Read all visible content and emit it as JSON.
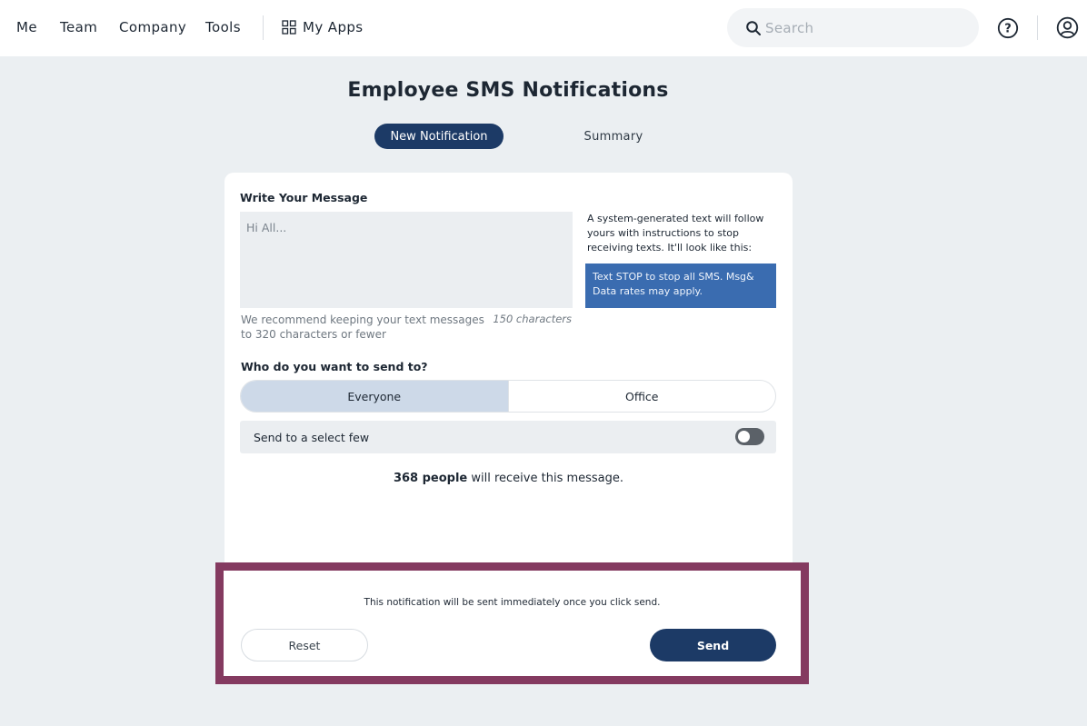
{
  "nav": {
    "items": [
      "Me",
      "Team",
      "Company",
      "Tools"
    ],
    "my_apps": "My Apps"
  },
  "search": {
    "placeholder": "Search"
  },
  "icons": {
    "apps": "grid-icon",
    "search": "search-icon",
    "help": "help-icon",
    "user": "user-icon"
  },
  "page": {
    "title": "Employee SMS Notifications",
    "tabs": [
      "New Notification",
      "Summary"
    ],
    "active_tab": "New Notification"
  },
  "message": {
    "label": "Write Your Message",
    "placeholder": "Hi All...",
    "hint": "We recommend keeping your text messages to 320 characters or fewer",
    "char_count": "150 characters",
    "system_note": "A system-generated text will follow yours with instructions to stop receiving texts. It'll look like this:",
    "stop_preview": "Text STOP to stop all SMS. Msg& Data rates may apply."
  },
  "audience": {
    "label": "Who do you want to send to?",
    "options": [
      "Everyone",
      "Office"
    ],
    "selected": "Everyone",
    "select_few_label": "Send to a select few",
    "select_few_enabled": false
  },
  "recipients": {
    "count": "368 people",
    "suffix": " will receive this message."
  },
  "footer": {
    "note": "This notification will be sent immediately once you click send.",
    "reset_label": "Reset",
    "send_label": "Send"
  },
  "colors": {
    "primary": "#1c3a66",
    "highlight_border": "#843a60",
    "preview_bg": "#3a6cb0",
    "selected_segment": "#cdd9e8",
    "page_bg": "#ebeff2"
  }
}
